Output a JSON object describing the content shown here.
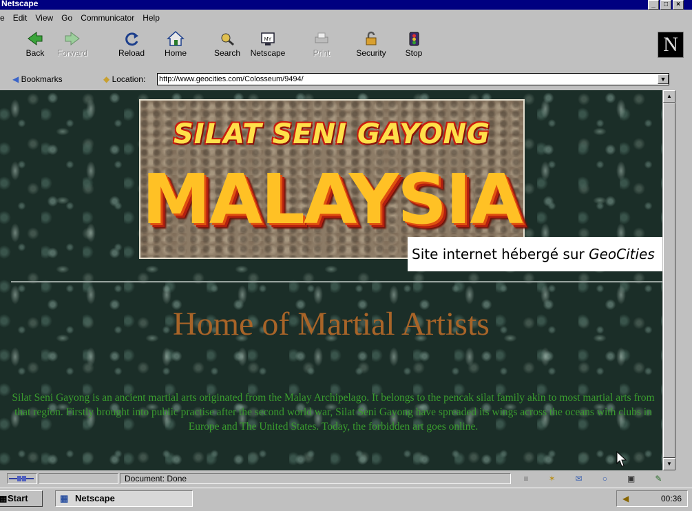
{
  "window": {
    "title": "Netscape",
    "controls": [
      "_",
      "□",
      "×"
    ]
  },
  "menubar": [
    {
      "label": "e"
    },
    {
      "label": "Edit"
    },
    {
      "label": "View"
    },
    {
      "label": "Go"
    },
    {
      "label": "Communicator"
    },
    {
      "label": "Help"
    }
  ],
  "toolbar": {
    "back": "Back",
    "forward": "Forward",
    "reload": "Reload",
    "home": "Home",
    "search": "Search",
    "netscape": "Netscape",
    "print": "Print",
    "security": "Security",
    "stop": "Stop",
    "logo_letter": "N"
  },
  "location_bar": {
    "bookmarks_label": "Bookmarks",
    "location_label": "Location:",
    "url": "http://www.geocities.com/Colosseum/9494/"
  },
  "page": {
    "banner_subtitle": "SILAT SENI GAYONG",
    "banner_title": "MALAYSIA",
    "caption_prefix": "Site internet hébergé sur ",
    "caption_italic": "GeoCities",
    "heading": "Home of Martial Artists",
    "intro": "Silat Seni Gayong is an ancient martial arts originated from the Malay Archipelago. It belongs to the pencak silat family akin to most martial arts from that region. Firstly brought into public practise after the second world war, Silat Seni Gayong have spreaded its wings across the oceans with clubs in Europe and The United States. Today, the forbidden art goes online."
  },
  "statusbar": {
    "text": "Document: Done"
  },
  "taskbar": {
    "start_label": "Start",
    "task_label": "Netscape",
    "clock": "00:36"
  },
  "colors": {
    "titlebar": "#000080",
    "heading": "#a86428",
    "intro_text": "#3a9c2e",
    "banner_main": "#ffc125",
    "banner_sub": "#ffe04a"
  }
}
